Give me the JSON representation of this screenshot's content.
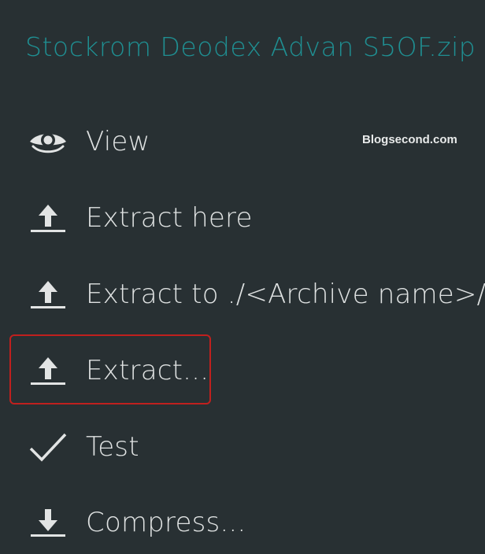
{
  "title": "Stockrom Deodex Advan S5OF.zip",
  "watermark": "Blogsecond.com",
  "menu": {
    "items": [
      {
        "label": "View",
        "icon": "eye-icon"
      },
      {
        "label": "Extract here",
        "icon": "upload-icon"
      },
      {
        "label": "Extract to ./<Archive name>/",
        "icon": "upload-icon"
      },
      {
        "label": "Extract...",
        "icon": "upload-icon",
        "highlighted": true
      },
      {
        "label": "Test",
        "icon": "checkmark-icon"
      },
      {
        "label": "Compress...",
        "icon": "download-icon"
      }
    ]
  },
  "colors": {
    "background": "#283033",
    "title": "#1f8f92",
    "text": "#dfe2e2",
    "highlight_border": "#c0201e"
  }
}
